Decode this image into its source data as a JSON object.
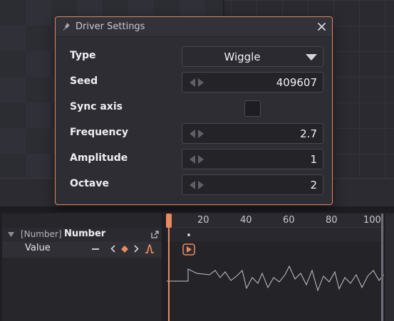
{
  "dialog": {
    "title": "Driver Settings",
    "rows": [
      {
        "label": "Type",
        "kind": "select",
        "value": "Wiggle"
      },
      {
        "label": "Seed",
        "kind": "number",
        "value": "409607"
      },
      {
        "label": "Sync axis",
        "kind": "checkbox",
        "checked": false
      },
      {
        "label": "Frequency",
        "kind": "number",
        "value": "2.7"
      },
      {
        "label": "Amplitude",
        "kind": "number",
        "value": "1"
      },
      {
        "label": "Octave",
        "kind": "number",
        "value": "2"
      }
    ]
  },
  "layers": {
    "layer": {
      "type": "[Number]",
      "name": "Number"
    },
    "property": {
      "name": "Value"
    }
  },
  "timeline": {
    "ticks": [
      "20",
      "40",
      "60",
      "80",
      "100"
    ]
  },
  "colors": {
    "accent": "#ea8a5e",
    "dialog_border": "#e0875f",
    "panel_bg": "#2d2d33"
  }
}
